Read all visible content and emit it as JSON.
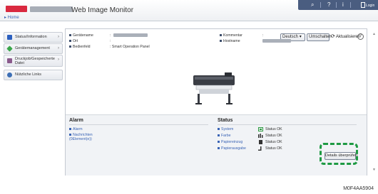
{
  "header": {
    "app_title": "Web Image Monitor",
    "colors": {
      "brand": "#d9293f",
      "topbar": "#4a5d80"
    }
  },
  "topbar": {
    "search_icon": "search-icon",
    "help_label": "?",
    "info_label": "i",
    "login_label": "Login"
  },
  "breadcrumb": {
    "home_label": "▸ Home"
  },
  "sidebar": {
    "items": [
      {
        "label": "Status/Information",
        "icon": "info-icon",
        "color": "#2b5fbf"
      },
      {
        "label": "Gerätemanagement",
        "icon": "device-management-icon",
        "color": "#3aa64a"
      },
      {
        "label": "Druckjob/Gespeicherte Datei",
        "icon": "print-job-icon",
        "color": "#8a5a8c"
      },
      {
        "label": "Nützliche Links",
        "icon": "links-icon",
        "color": "#3d6fb5"
      }
    ]
  },
  "controls": {
    "language": "Deutsch",
    "reset_label": "Umschalten",
    "refresh_label": "Aktualisieren",
    "help_label": "?"
  },
  "device": {
    "device_name_label": "Gerätename",
    "location_label": "Ort",
    "location_value": ":",
    "panel_label": "Bedienfeld",
    "panel_value": ": Smart Operation Panel",
    "comment_label": "Kommentar",
    "comment_value": ":",
    "hostname_label": "Hostname"
  },
  "alarm": {
    "title": "Alarm",
    "links": [
      "Alarm",
      "Nachrichten (0Element(e))"
    ]
  },
  "status": {
    "title": "Status",
    "rows": [
      {
        "label": "System",
        "value": "Status OK",
        "icon": "system-status-icon"
      },
      {
        "label": "Farbe",
        "value": "Status OK",
        "icon": "color-status-icon"
      },
      {
        "label": "Papiereinzug",
        "value": "Status OK",
        "icon": "paper-feed-icon"
      },
      {
        "label": "Papierausgabe",
        "value": "Status OK",
        "icon": "paper-output-icon"
      }
    ]
  },
  "details_button": "Details überprüfen",
  "figure_code": "M0F4AA5904"
}
